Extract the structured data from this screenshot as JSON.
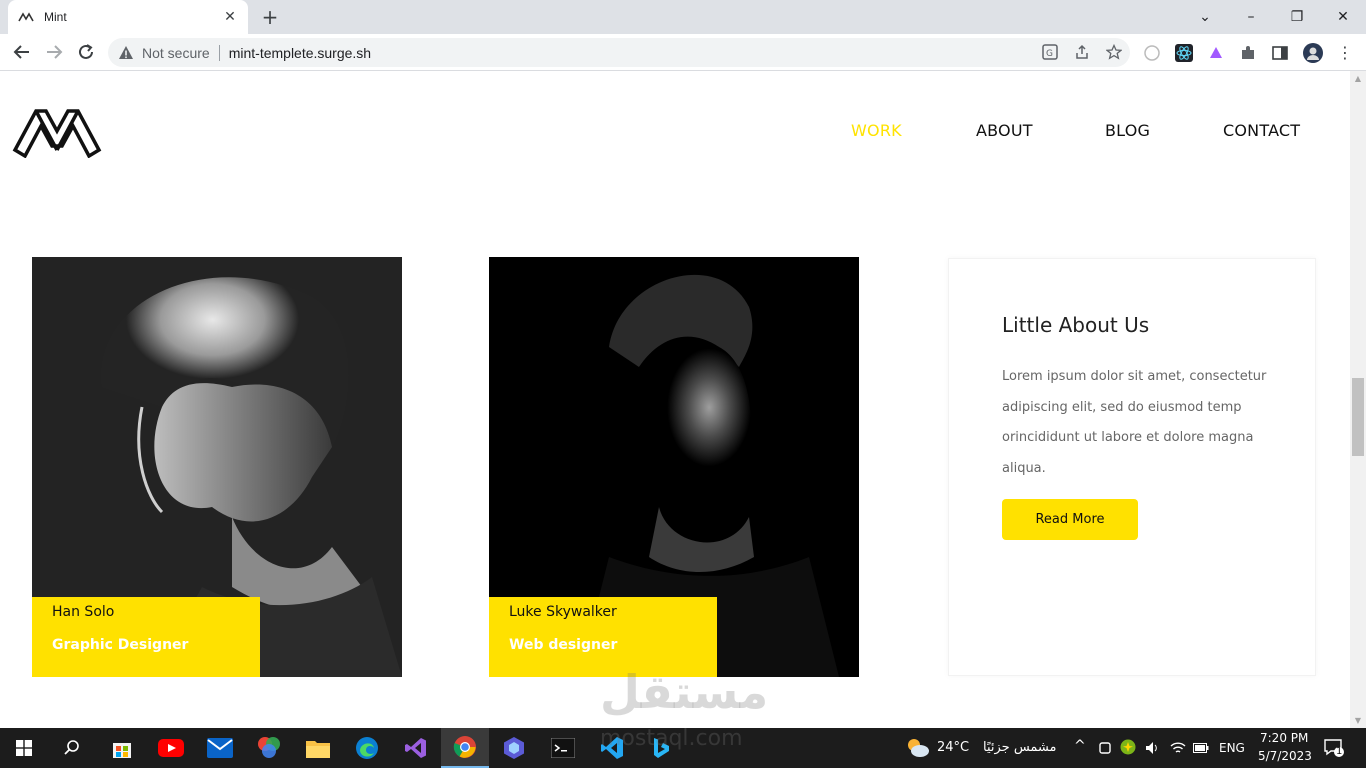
{
  "browser": {
    "tab_title": "Mint",
    "not_secure": "Not secure",
    "url": "mint-templete.surge.sh"
  },
  "nav": {
    "items": [
      {
        "label": "WORK",
        "active": true
      },
      {
        "label": "ABOUT",
        "active": false
      },
      {
        "label": "BLOG",
        "active": false
      },
      {
        "label": "CONTACT",
        "active": false
      }
    ]
  },
  "team": [
    {
      "name": "Han Solo",
      "role": "Graphic Designer"
    },
    {
      "name": "Luke Skywalker",
      "role": "Web designer"
    }
  ],
  "about": {
    "title": "Little About Us",
    "text": "Lorem ipsum dolor sit amet, consectetur adipiscing elit, sed do eiusmod temp orincididunt ut labore et dolore magna aliqua.",
    "button": "Read More"
  },
  "watermark": {
    "arabic": "مستقل",
    "latin": "mostaql.com"
  },
  "taskbar": {
    "temperature": "24°C",
    "weather": "مشمس جزئيًا",
    "lang": "ENG",
    "time": "7:20 PM",
    "date": "5/7/2023",
    "notifications": "1"
  },
  "colors": {
    "accent": "#ffe100",
    "nav_active": "#ffe300"
  }
}
